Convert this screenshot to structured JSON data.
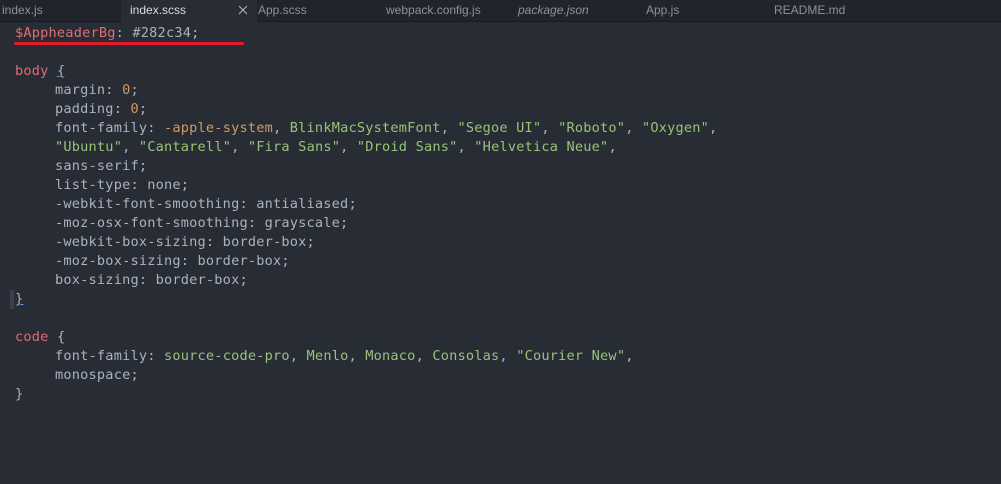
{
  "tabs": [
    {
      "label": "index.js",
      "active": false,
      "italic": false
    },
    {
      "label": "index.scss",
      "active": true,
      "italic": false
    },
    {
      "label": "App.scss",
      "active": false,
      "italic": false
    },
    {
      "label": "webpack.config.js",
      "active": false,
      "italic": false
    },
    {
      "label": "package.json",
      "active": false,
      "italic": true
    },
    {
      "label": "App.js",
      "active": false,
      "italic": false
    },
    {
      "label": "README.md",
      "active": false,
      "italic": false
    }
  ],
  "colors": {
    "editor_bg": "#282c34",
    "tabbar_bg": "#21252b",
    "variable": "#e06c75",
    "number": "#d19a66",
    "string": "#98c379",
    "annotation": "#e8192c"
  },
  "code": {
    "var_name": "$AppheaderBg",
    "var_colon": ": ",
    "var_value": "#282c34;",
    "body_selector": "body",
    "open_brace": "{",
    "close_brace": "}",
    "margin_prop": "margin: ",
    "margin_val": "0",
    "padding_prop": "padding: ",
    "padding_val": "0",
    "semi": ";",
    "ff_prop": "font-family: ",
    "ff_1": "-apple-system",
    "ff_2": "BlinkMacSystemFont",
    "ff_3": "\"Segoe UI\"",
    "ff_4": "\"Roboto\"",
    "ff_5": "\"Oxygen\"",
    "ff_6": "\"Ubuntu\"",
    "ff_7": "\"Cantarell\"",
    "ff_8": "\"Fira Sans\"",
    "ff_9": "\"Droid Sans\"",
    "ff_10": "\"Helvetica Neue\"",
    "sans_serif": "sans-serif;",
    "list_type": "list-type: none;",
    "webkit_smoothing": "-webkit-font-smoothing: antialiased;",
    "moz_smoothing": "-moz-osx-font-smoothing: grayscale;",
    "webkit_box": "-webkit-box-sizing: border-box;",
    "moz_box": "-moz-box-sizing: border-box;",
    "box_sizing": "box-sizing: border-box;",
    "code_selector": "code",
    "code_ff_1": "source-code-pro",
    "code_ff_2": "Menlo",
    "code_ff_3": "Monaco",
    "code_ff_4": "Consolas",
    "code_ff_5": "\"Courier New\"",
    "monospace": "monospace;"
  }
}
